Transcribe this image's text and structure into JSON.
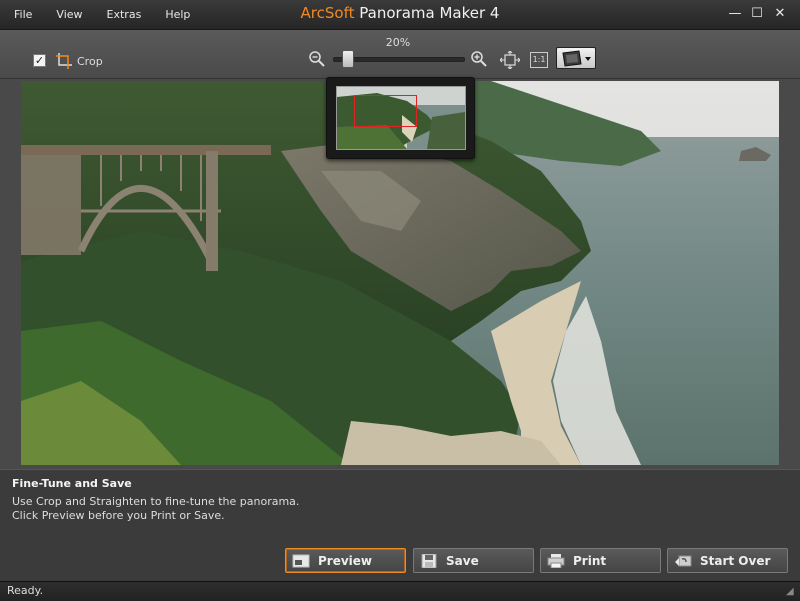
{
  "app": {
    "title_brand": "ArcSoft",
    "title_rest": "Panorama Maker 4",
    "brand_color": "#f08a24"
  },
  "menu": {
    "items": [
      "File",
      "View",
      "Extras",
      "Help"
    ]
  },
  "window_controls": {
    "minimize": "—",
    "maximize": "☐",
    "close": "✕"
  },
  "toolbar": {
    "crop_label": "Crop",
    "crop_checked": true,
    "zoom_percent": "20%",
    "zoom_level": 0.08,
    "one_to_one_label": "1:1"
  },
  "step": {
    "title": "Fine-Tune and Save",
    "line1": "Use Crop and Straighten to fine-tune the panorama.",
    "line2": "Click Preview before you Print or Save."
  },
  "buttons": {
    "preview": "Preview",
    "save": "Save",
    "print": "Print",
    "start_over": "Start Over"
  },
  "status": {
    "text": "Ready."
  },
  "icons": {
    "crop": "crop-icon",
    "zoom_out": "zoom-out-icon",
    "zoom_in": "zoom-in-icon",
    "fit": "fit-to-window-icon",
    "view_mode": "view-mode-icon",
    "preview": "preview-icon",
    "save": "save-icon",
    "print": "print-icon",
    "start_over": "start-over-icon"
  }
}
